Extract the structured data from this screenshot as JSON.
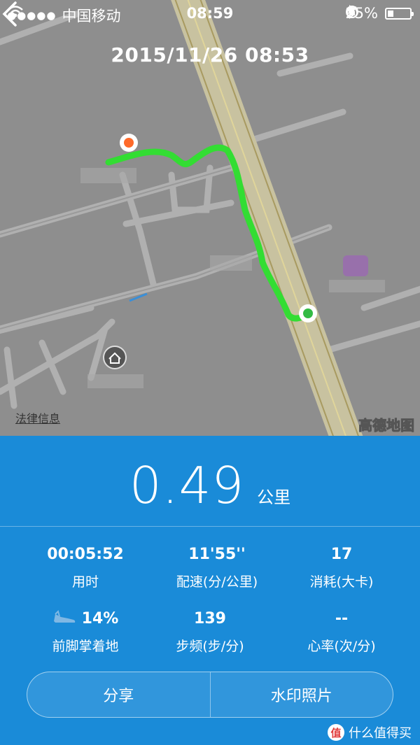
{
  "status_bar": {
    "signal": "●●●●●",
    "carrier": "中国移动",
    "time": "08:59",
    "battery_percent": "25%",
    "battery_level": 0.25
  },
  "header": {
    "title": "2015/11/26 08:53"
  },
  "map": {
    "legal_info": "法律信息",
    "provider": "高德地图"
  },
  "summary": {
    "distance_value": "0.49",
    "distance_unit": "公里"
  },
  "stats": [
    {
      "value": "00:05:52",
      "label": "用时"
    },
    {
      "value": "11'55''",
      "label": "配速(分/公里)"
    },
    {
      "value": "17",
      "label": "消耗(大卡)"
    },
    {
      "value": "14%",
      "label": "前脚掌着地"
    },
    {
      "value": "139",
      "label": "步频(步/分)"
    },
    {
      "value": "--",
      "label": "心率(次/分)"
    }
  ],
  "actions": {
    "share": "分享",
    "watermark_photo": "水印照片"
  },
  "watermark": {
    "logo": "值",
    "text": "什么值得买"
  },
  "colors": {
    "panel": "#1a8bd8",
    "route": "#33dd33",
    "start_marker": "#33bb44",
    "end_marker": "#ff6a2a",
    "map_bg": "#8e8e8e"
  }
}
